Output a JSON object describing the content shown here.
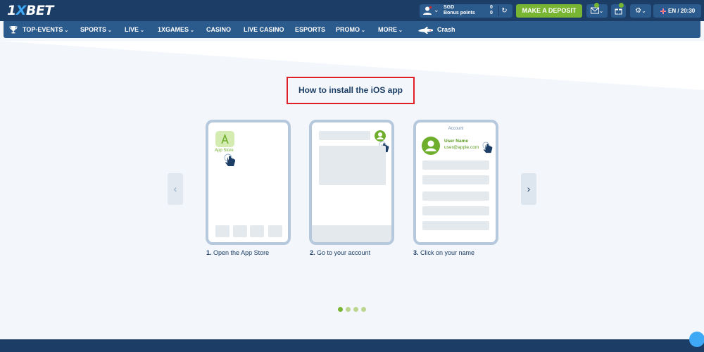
{
  "header": {
    "logo_prefix": "1",
    "logo_x": "X",
    "logo_suffix": "BET",
    "currency": "SGD",
    "bonus_label": "Bonus points",
    "balance": "0",
    "bonus_value": "0",
    "deposit_label": "MAKE A DEPOSIT",
    "language": "EN / 20:30",
    "icons": [
      "user-icon",
      "refresh-icon",
      "mail-icon",
      "gift-icon",
      "settings-icon",
      "flag-icon"
    ]
  },
  "nav": {
    "items": [
      {
        "label": "TOP-EVENTS",
        "dropdown": true
      },
      {
        "label": "SPORTS",
        "dropdown": true
      },
      {
        "label": "LIVE",
        "dropdown": true
      },
      {
        "label": "1XGAMES",
        "dropdown": true
      },
      {
        "label": "CASINO",
        "dropdown": false
      },
      {
        "label": "LIVE CASINO",
        "dropdown": false
      },
      {
        "label": "ESPORTS",
        "dropdown": false
      },
      {
        "label": "PROMO",
        "dropdown": true
      },
      {
        "label": "MORE",
        "dropdown": true
      },
      {
        "label": "Crash",
        "dropdown": false
      }
    ]
  },
  "page": {
    "title": "How to install the iOS app",
    "phone1": {
      "app_label": "App Store"
    },
    "phone3": {
      "header": "Account",
      "user_name": "User Name",
      "email": "user@apple.com"
    },
    "steps": [
      {
        "num": "1.",
        "text": "Open the App Store"
      },
      {
        "num": "2.",
        "text": "Go to your account"
      },
      {
        "num": "3.",
        "text": "Click on your name"
      }
    ],
    "slides_total": 4,
    "slide_active": 1
  },
  "colors": {
    "header_bg": "#1b3d66",
    "nav_bg": "#2b5a8c",
    "accent_green": "#78b533",
    "highlight_red": "#e01f26",
    "page_bg": "#f3f7fb"
  }
}
